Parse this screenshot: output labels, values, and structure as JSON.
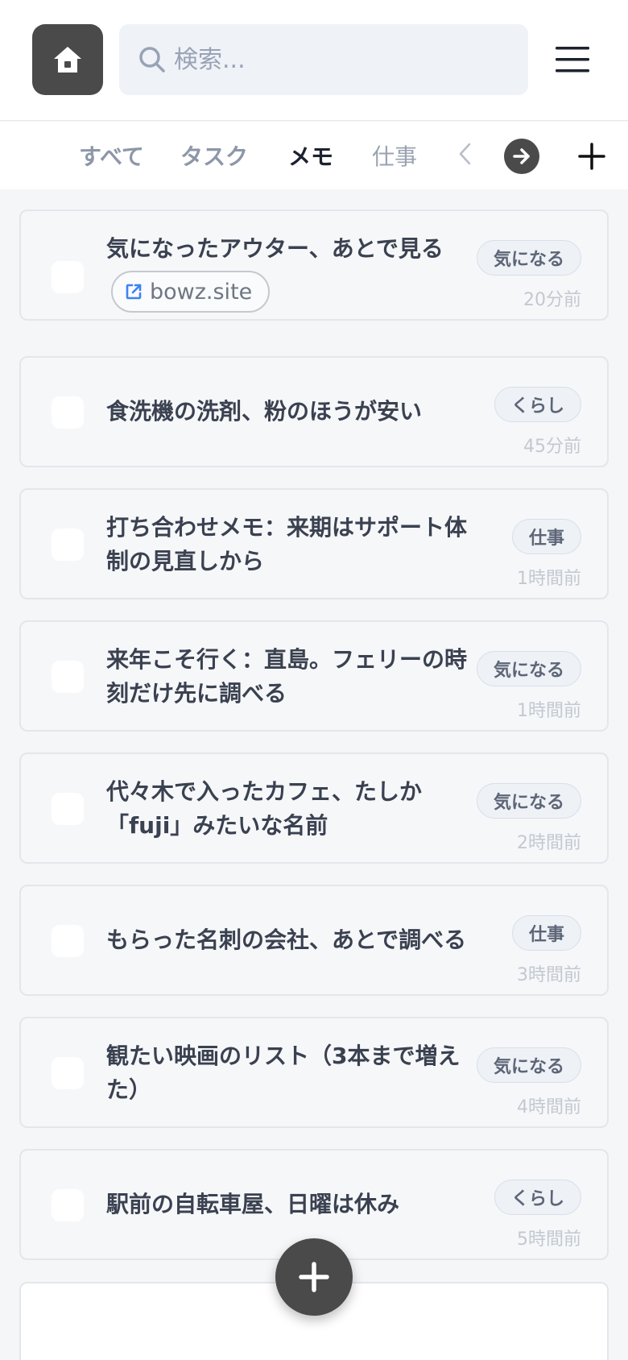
{
  "search": {
    "placeholder": "検索..."
  },
  "tabs": [
    {
      "label": "すべて",
      "state": "inactive"
    },
    {
      "label": "タスク",
      "state": "inactive"
    },
    {
      "label": "メモ",
      "state": "active"
    },
    {
      "label": "仕事",
      "state": "inactive"
    }
  ],
  "items": [
    {
      "title": "気になったアウター、あとで見る",
      "link": "bowz.site",
      "tag": "気になる",
      "time": "20分前"
    },
    {
      "title": "食洗機の洗剤、粉のほうが安い",
      "tag": "くらし",
      "time": "45分前"
    },
    {
      "title": "打ち合わせメモ：来期はサポート体制の見直しから",
      "tag": "仕事",
      "time": "1時間前"
    },
    {
      "title": "来年こそ行く：直島。フェリーの時刻だけ先に調べる",
      "tag": "気になる",
      "time": "1時間前"
    },
    {
      "title": "代々木で入ったカフェ、たしか「fuji」みたいな名前",
      "tag": "気になる",
      "time": "2時間前"
    },
    {
      "title": "もらった名刺の会社、あとで調べる",
      "tag": "仕事",
      "time": "3時間前"
    },
    {
      "title": "観たい映画のリスト（3本まで増えた）",
      "tag": "気になる",
      "time": "4時間前"
    },
    {
      "title": "駅前の自転車屋、日曜は休み",
      "tag": "くらし",
      "time": "5時間前"
    }
  ],
  "icons": {
    "home": "home-icon",
    "search": "search-icon",
    "menu": "hamburger-menu-icon",
    "tab_prev": "chevron-left-icon",
    "tab_next": "arrow-right-icon",
    "tab_add": "plus-icon",
    "link": "external-link-icon",
    "fab": "plus-icon"
  },
  "colors": {
    "accent_dark": "#4a4a4a",
    "link_icon": "#3b82f6",
    "background": "#f5f6f8"
  }
}
